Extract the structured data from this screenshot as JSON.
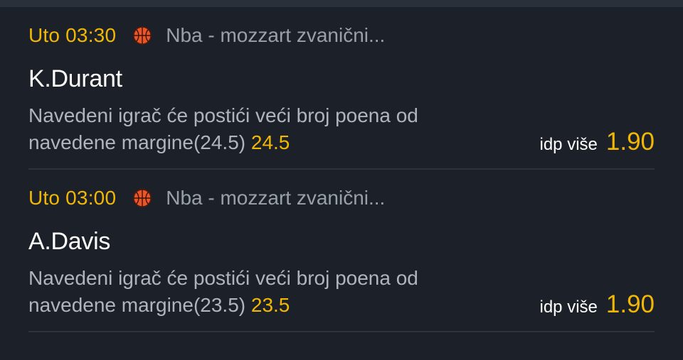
{
  "bets": [
    {
      "time": "Uto 03:30",
      "sport_icon": "basketball-icon",
      "league": "Nba - mozzart zvanični...",
      "player": "K.Durant",
      "description_line1": "Navedeni igrač će postići veći broj poena od",
      "description_line2": "navedene margine(24.5)",
      "margin_value": "24.5",
      "odds_label": "idp više",
      "odds_value": "1.90"
    },
    {
      "time": "Uto 03:00",
      "sport_icon": "basketball-icon",
      "league": "Nba - mozzart zvanični...",
      "player": "A.Davis",
      "description_line1": "Navedeni igrač će postići veći broj poena od",
      "description_line2": "navedene margine(23.5)",
      "margin_value": "23.5",
      "odds_label": "idp više",
      "odds_value": "1.90"
    }
  ],
  "colors": {
    "accent": "#f2b705",
    "background": "#1c2129",
    "muted_text": "#9aa0a8",
    "ball_orange": "#e8562a"
  }
}
